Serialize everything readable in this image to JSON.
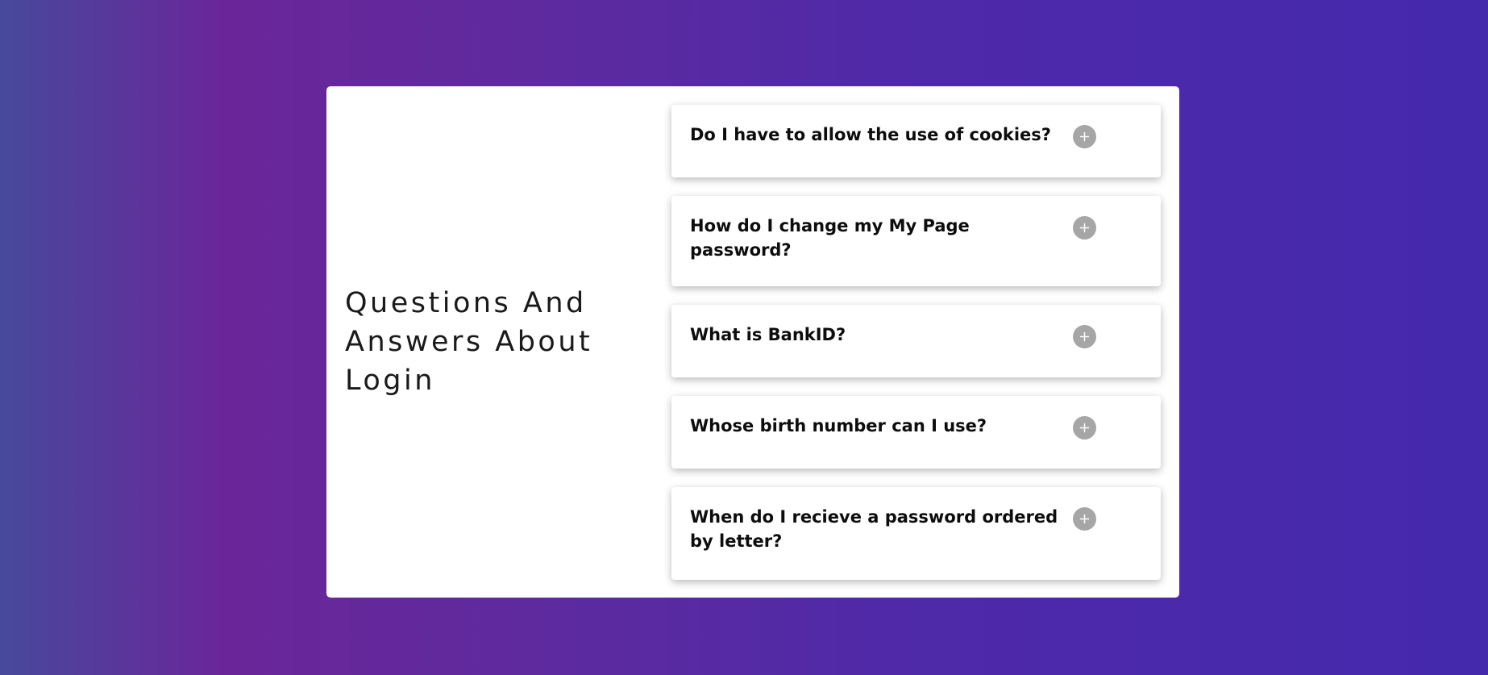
{
  "title": "Questions And Answers About Login",
  "faq": [
    {
      "question": "Do I have to allow the use of cookies?",
      "icon": "plus-icon"
    },
    {
      "question": "How do I change my My Page password?",
      "icon": "plus-icon"
    },
    {
      "question": "What is BankID?",
      "icon": "plus-icon"
    },
    {
      "question": "Whose birth number can I use?",
      "icon": "plus-icon"
    },
    {
      "question": "When do I recieve a password ordered by letter?",
      "icon": "plus-icon"
    }
  ],
  "colors": {
    "background_gradient": [
      "#47499c",
      "#6a2699",
      "#4429ad"
    ],
    "card": "#ffffff",
    "icon_circle": "#a6a6a6",
    "text": "#0d0d0d"
  }
}
